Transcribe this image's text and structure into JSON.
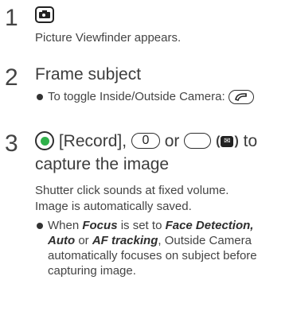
{
  "steps": [
    {
      "number": "1",
      "key_icon": "camera-key-icon",
      "description": "Picture Viewfinder appears."
    },
    {
      "number": "2",
      "heading": "Frame subject",
      "bullet_text": "To toggle Inside/Outside Camera:",
      "key_icon": "call-key-icon"
    },
    {
      "number": "3",
      "heading_record": "[Record],",
      "heading_or": "or",
      "heading_badge_open": "(",
      "heading_badge_symbol": "✉",
      "heading_badge_close": ")",
      "heading_to": "to",
      "heading_line2": "capture the image",
      "zero_key_label": "0",
      "description_lines": [
        "Shutter click sounds at fixed volume.",
        "Image is automatically saved."
      ],
      "bullet": {
        "when": "When",
        "focus": "Focus",
        "is_set_to": "is set to",
        "face_detection": "Face Detection,",
        "auto": "Auto",
        "or": "or",
        "af_tracking": "AF tracking",
        "rest_line1": ", Outside Camera",
        "line2": "automatically focuses on subject before",
        "line3": "capturing image."
      }
    }
  ]
}
